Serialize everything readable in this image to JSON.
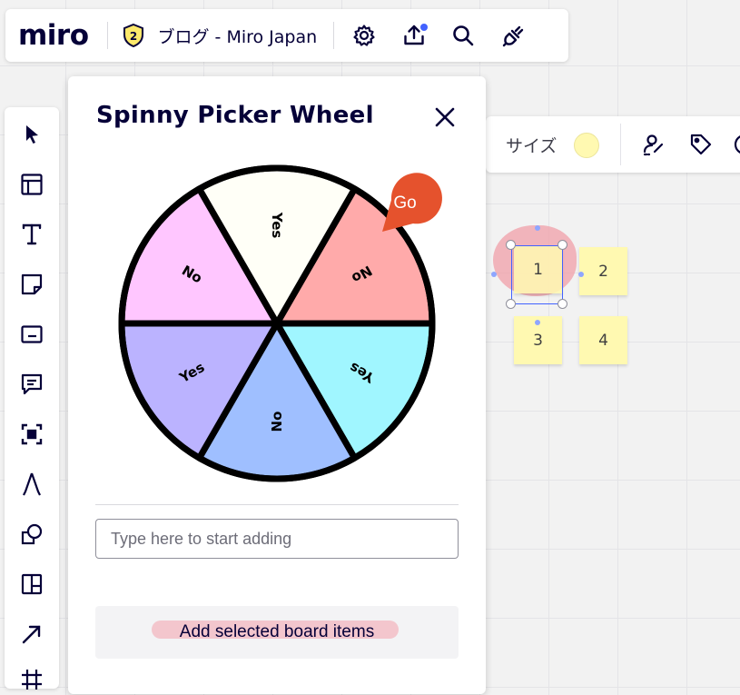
{
  "app": {
    "logo": "miro",
    "board_name": "ブログ - Miro Japan",
    "plan_badge": "2"
  },
  "topbar_icons": [
    "plan-badge-icon",
    "settings-gear-icon",
    "upload-share-icon",
    "search-icon",
    "plug-integrations-icon"
  ],
  "toolbar_icons": [
    "select-cursor-icon",
    "templates-frame-icon",
    "text-icon",
    "sticky-note-icon",
    "card-icon",
    "comment-icon",
    "frame-icon",
    "pen-icon",
    "shapes-icon",
    "kanban-icon",
    "arrow-line-icon",
    "grid-icon"
  ],
  "context_toolbar": {
    "size_label": "サイズ",
    "size_color": "#fff9b1"
  },
  "panel": {
    "title": "Spinny Picker Wheel",
    "go_label": "Go",
    "go_color": "#e5522d",
    "input_placeholder": "Type here to start adding",
    "add_button_label": "Add selected board items"
  },
  "wheel": {
    "segments": [
      {
        "label": "No",
        "color": "#ffaaaa"
      },
      {
        "label": "Yes",
        "color": "#a0f6ff"
      },
      {
        "label": "No",
        "color": "#9fbfff"
      },
      {
        "label": "Yes",
        "color": "#bbb3ff"
      },
      {
        "label": "No",
        "color": "#ffc6ff"
      },
      {
        "label": "Yes",
        "color": "#fffff7"
      }
    ]
  },
  "board_notes": [
    {
      "label": "1"
    },
    {
      "label": "2"
    },
    {
      "label": "3"
    },
    {
      "label": "4"
    }
  ]
}
